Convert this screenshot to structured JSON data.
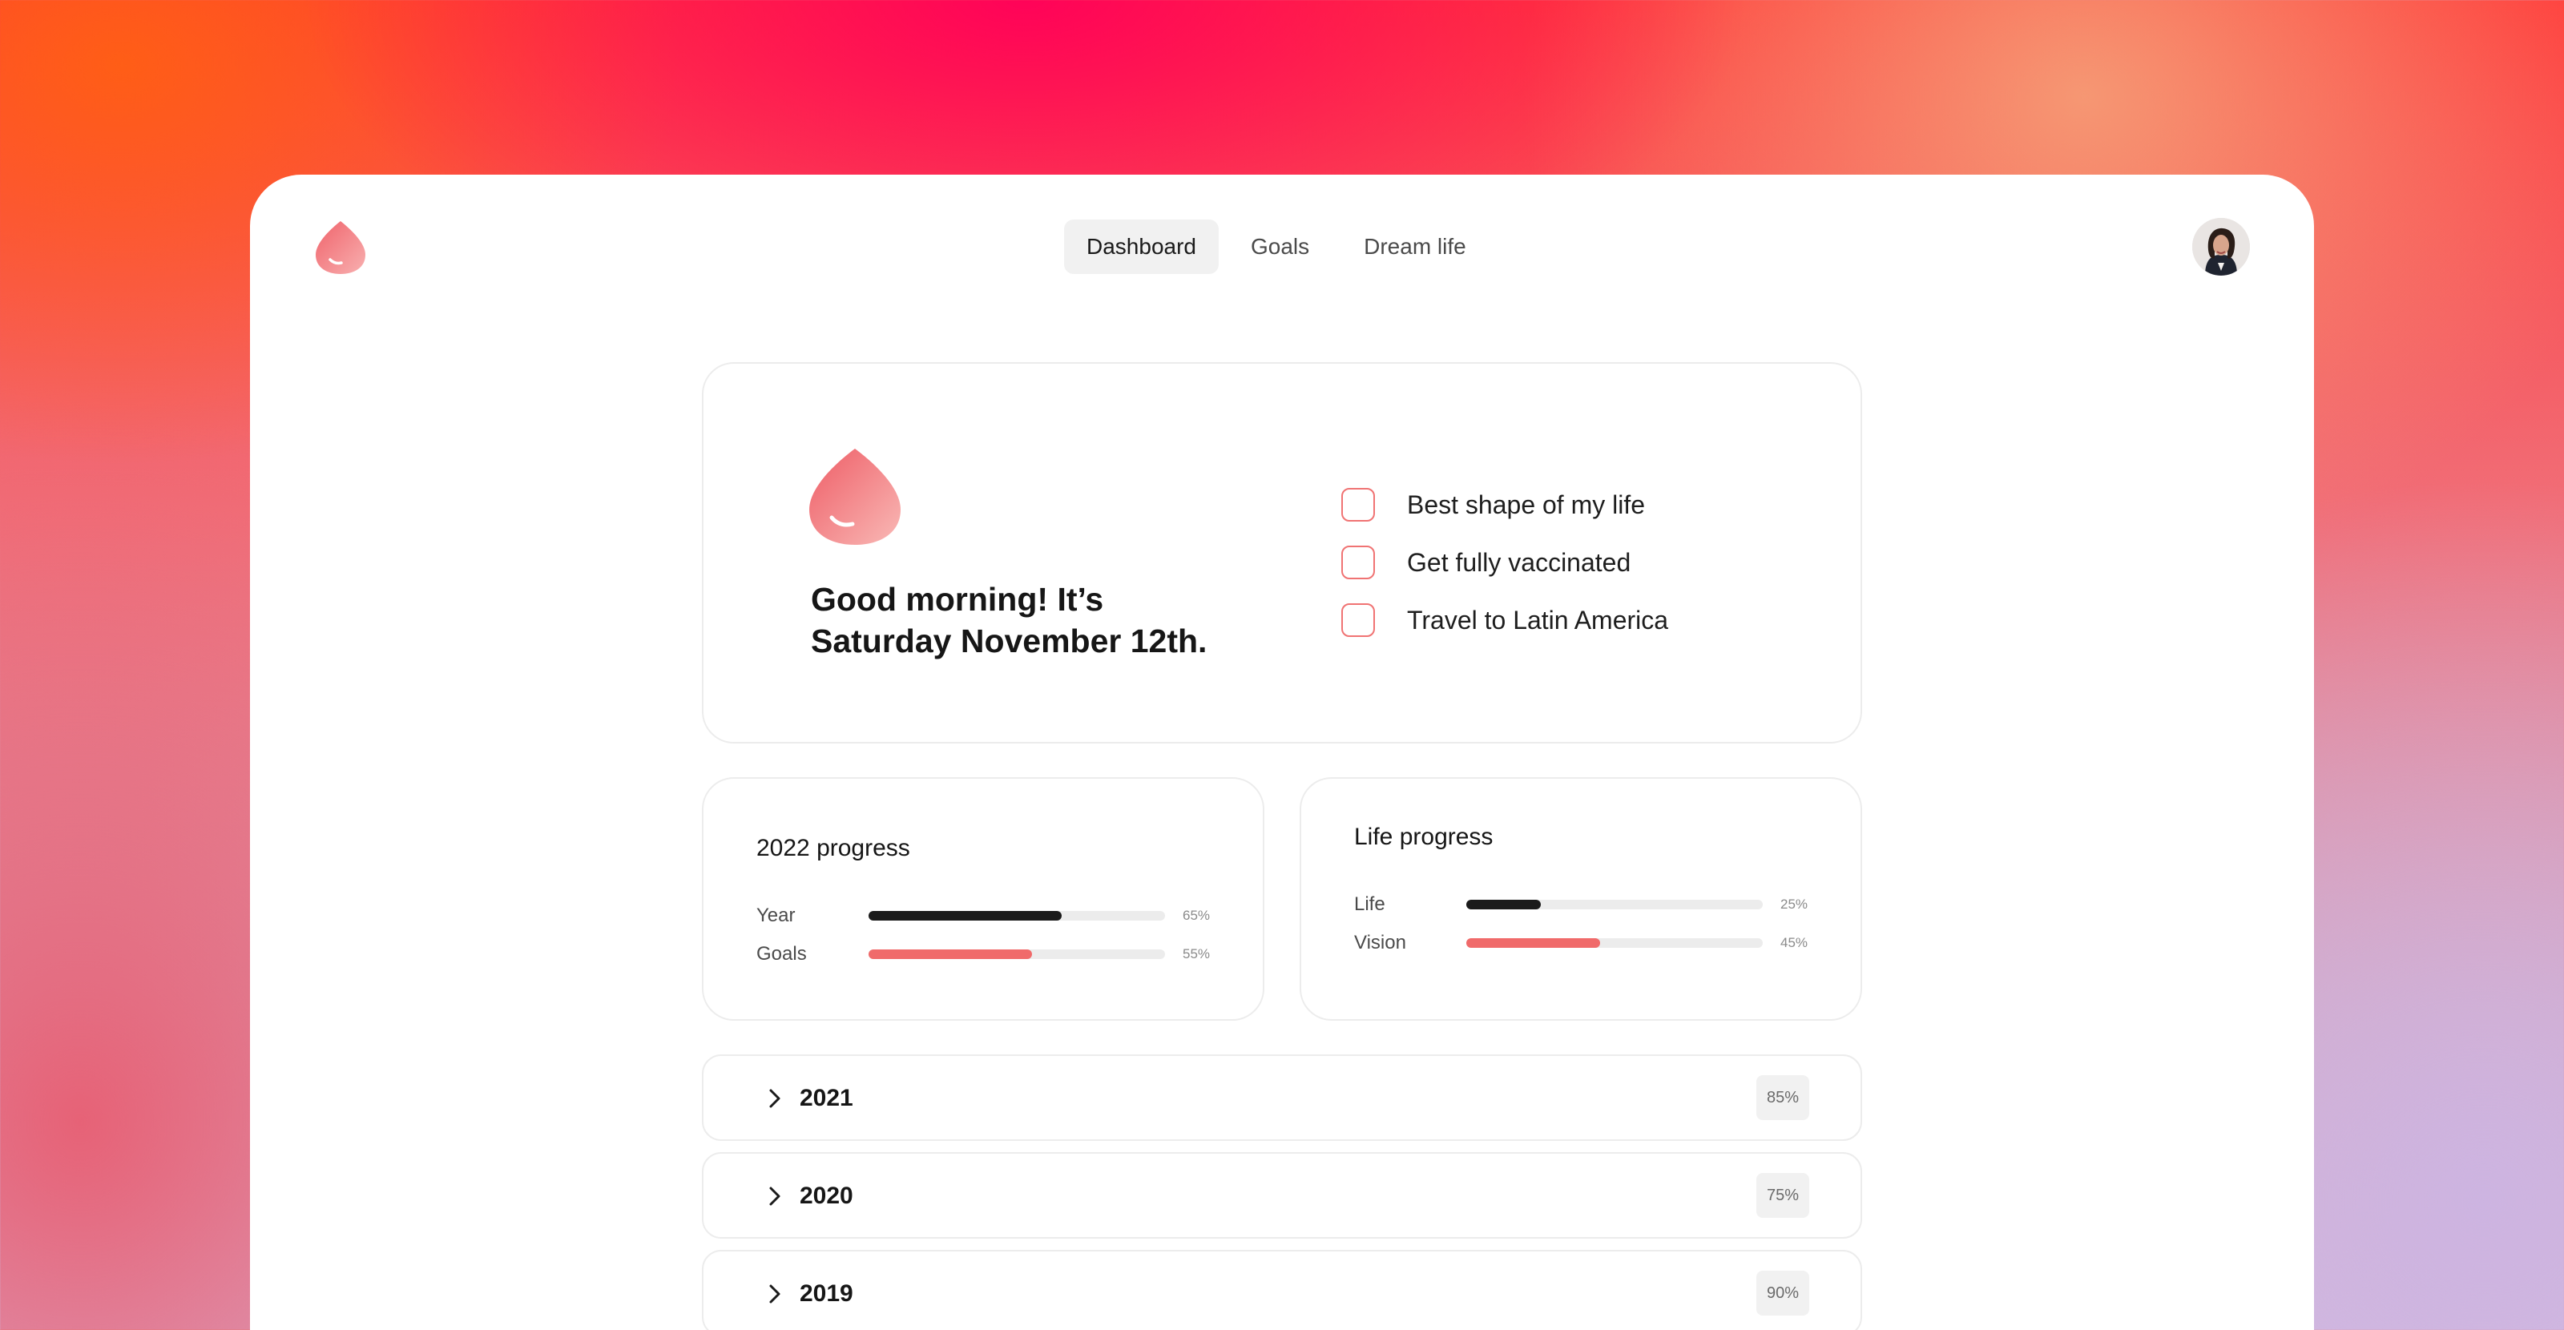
{
  "nav": {
    "items": [
      {
        "label": "Dashboard",
        "active": true
      },
      {
        "label": "Goals",
        "active": false
      },
      {
        "label": "Dream life",
        "active": false
      }
    ]
  },
  "hero": {
    "greeting_line1": "Good morning! It’s",
    "greeting_line2": "Saturday November 12th.",
    "goals": [
      {
        "label": "Best shape of my life",
        "checked": false
      },
      {
        "label": "Get fully vaccinated",
        "checked": false
      },
      {
        "label": "Travel to Latin America",
        "checked": false
      }
    ]
  },
  "progress_2022": {
    "title": "2022 progress",
    "bars": [
      {
        "label": "Year",
        "value": 0.65,
        "pct": "65%",
        "color": "#1b1b1b"
      },
      {
        "label": "Goals",
        "value": 0.55,
        "pct": "55%",
        "color": "#f06a6a"
      }
    ]
  },
  "life_progress": {
    "title": "Life progress",
    "bars": [
      {
        "label": "Life",
        "value": 0.25,
        "pct": "25%",
        "color": "#1b1b1b"
      },
      {
        "label": "Vision",
        "value": 0.45,
        "pct": "45%",
        "color": "#f06a6a"
      }
    ]
  },
  "years": [
    {
      "label": "2021",
      "pct": "85%"
    },
    {
      "label": "2020",
      "pct": "75%"
    },
    {
      "label": "2019",
      "pct": "90%"
    }
  ],
  "colors": {
    "accent": "#f06a6a",
    "dark": "#1b1b1b"
  }
}
